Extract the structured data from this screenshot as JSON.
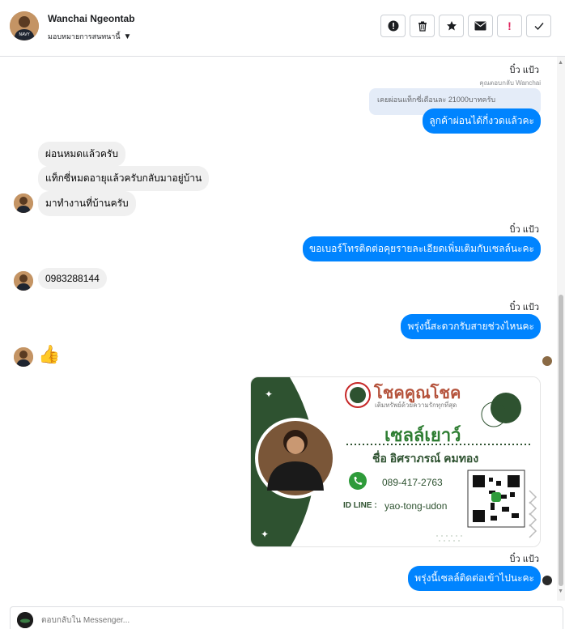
{
  "header": {
    "name": "Wanchai Ngeontab",
    "assign_label": "มอบหมายการสนทนานี้",
    "actions": [
      {
        "name": "report-button",
        "icon": "exclamation-circle-icon"
      },
      {
        "name": "delete-button",
        "icon": "trash-icon"
      },
      {
        "name": "star-button",
        "icon": "star-icon"
      },
      {
        "name": "mark-unread-button",
        "icon": "envelope-icon"
      },
      {
        "name": "spam-button",
        "icon": "exclamation-icon"
      },
      {
        "name": "done-button",
        "icon": "check-icon"
      }
    ]
  },
  "messages": {
    "sender_1": "บิ๋ว แป้ว",
    "reply_note": "คุณตอบกลับ Wanchai",
    "quoted_text": "เคยผ่อนแท็กซี่เดือนละ 21000บาทครับ",
    "out_1": "ลูกค้าผ่อนได้กี่งวดแล้วคะ",
    "in_1": "ผ่อนหมดแล้วครับ",
    "in_2": "แท็กซี่หมดอายุแล้วครับกลับมาอยู่บ้าน",
    "in_3": "มาทำงานที่บ้านครับ",
    "sender_2": "บิ๋ว แป้ว",
    "out_2": "ขอเบอร์โทรติดต่อคุยรายละเอียดเพิ่มเติมกับเซลล์นะคะ",
    "in_4": "0983288144",
    "sender_3": "บิ๋ว แป้ว",
    "out_3": "พรุ่งนี้สะดวกรับสายช่วงไหนคะ",
    "in_5_emoji": "👍",
    "sender_4": "บิ๋ว แป้ว",
    "out_4": "พรุ่งนี้เซลล์ติดต่อเข้าไปนะคะ"
  },
  "card": {
    "brand": "โชคคูณโชค",
    "tagline": "เติมทรัพย์ด้วยความรักทุกที่สุด",
    "title": "เซลล์เยาว์",
    "person": "ชื่อ อิศราภรณ์ คมทอง",
    "phone": "089-417-2763",
    "line_label": "ID LINE :",
    "line_id": "yao-tong-udon",
    "green": "#2e5230"
  },
  "composer": {
    "placeholder": "ตอบกลับใน Messenger..."
  }
}
